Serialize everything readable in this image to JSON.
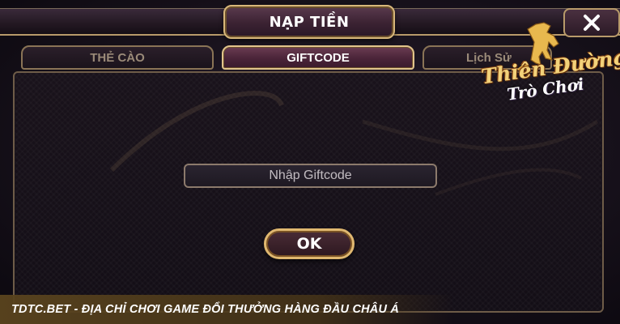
{
  "header": {
    "title": "NẠP TIỀN",
    "close_icon": "close-icon"
  },
  "tabs": [
    {
      "label": "THẺ CÀO",
      "active": false
    },
    {
      "label": "GIFTCODE",
      "active": true
    },
    {
      "label": "Lịch Sử",
      "active": false
    }
  ],
  "form": {
    "giftcode_placeholder": "Nhập Giftcode",
    "giftcode_value": "",
    "submit_label": "OK"
  },
  "logo": {
    "line1": "Thiên Đường",
    "line2": "Trò Chơi",
    "icon": "horse-icon"
  },
  "ribbon": {
    "text": "TDTC.BET - ĐỊA CHỈ CHƠI GAME ĐỔI THƯỞNG HÀNG ĐẦU CHÂU Á"
  },
  "colors": {
    "accent_gold": "#e0b870",
    "panel_bg": "#17111b",
    "active_tab": "#4a2438"
  }
}
